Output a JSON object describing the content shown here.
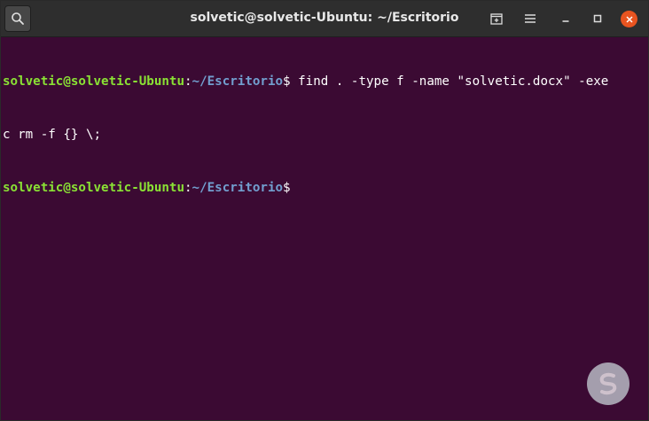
{
  "window": {
    "title": "solvetic@solvetic-Ubuntu: ~/Escritorio",
    "icons": {
      "search": "search-icon",
      "new_tab": "new-tab-icon",
      "menu": "hamburger-menu-icon",
      "minimize": "minimize-icon",
      "maximize": "maximize-icon",
      "close": "close-icon"
    },
    "close_color": "#e95420"
  },
  "terminal": {
    "background": "#3b0a33",
    "prompt_user_color": "#8ae234",
    "prompt_path_color": "#729fcf",
    "lines": [
      {
        "user": "solvetic@solvetic-Ubuntu",
        "sep": ":",
        "path": "~/Escritorio",
        "symbol": "$",
        "command": " find . -type f -name \"solvetic.docx\" -exe"
      },
      {
        "text": "c rm -f {} \\;"
      },
      {
        "user": "solvetic@solvetic-Ubuntu",
        "sep": ":",
        "path": "~/Escritorio",
        "symbol": "$",
        "command": ""
      }
    ]
  },
  "watermark": {
    "icon": "solvetic-logo-icon"
  }
}
